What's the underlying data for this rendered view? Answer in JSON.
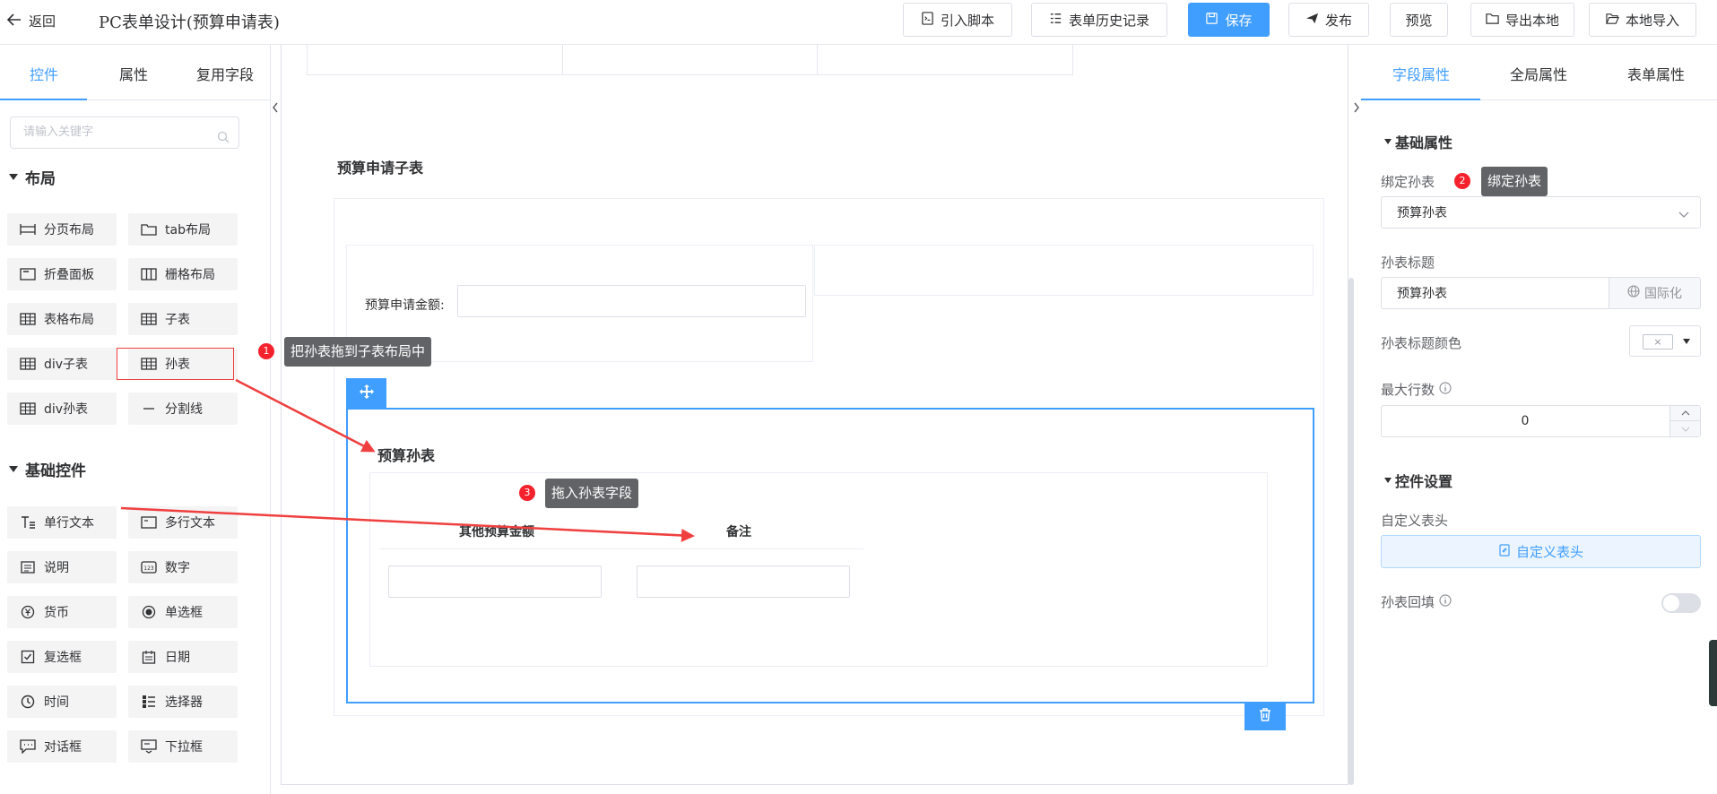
{
  "header": {
    "back_label": "返回",
    "title": "PC表单设计(预算申请表)",
    "buttons": {
      "import_script": "引入脚本",
      "history": "表单历史记录",
      "save": "保存",
      "publish": "发布",
      "preview": "预览",
      "export_local": "导出本地",
      "import_local": "本地导入"
    }
  },
  "left_panel": {
    "tabs": [
      "控件",
      "属性",
      "复用字段"
    ],
    "active_tab": "控件",
    "search_placeholder": "请输入关键字",
    "layout_section": "布局",
    "layout_items": [
      {
        "label": "分页布局",
        "icon": "page-layout-icon"
      },
      {
        "label": "tab布局",
        "icon": "folder-tab-icon"
      },
      {
        "label": "折叠面板",
        "icon": "collapse-panel-icon"
      },
      {
        "label": "栅格布局",
        "icon": "grid-columns-icon"
      },
      {
        "label": "表格布局",
        "icon": "table-icon"
      },
      {
        "label": "子表",
        "icon": "table-icon"
      },
      {
        "label": "div子表",
        "icon": "table-icon"
      },
      {
        "label": "孙表",
        "icon": "table-icon"
      },
      {
        "label": "div孙表",
        "icon": "table-icon"
      },
      {
        "label": "分割线",
        "icon": "divider-icon"
      }
    ],
    "basic_section": "基础控件",
    "basic_items": [
      {
        "label": "单行文本",
        "icon": "single-line-text-icon"
      },
      {
        "label": "多行文本",
        "icon": "multi-line-text-icon"
      },
      {
        "label": "说明",
        "icon": "description-icon"
      },
      {
        "label": "数字",
        "icon": "number-icon"
      },
      {
        "label": "货币",
        "icon": "currency-icon"
      },
      {
        "label": "单选框",
        "icon": "radio-icon"
      },
      {
        "label": "复选框",
        "icon": "checkbox-icon"
      },
      {
        "label": "日期",
        "icon": "calendar-icon"
      },
      {
        "label": "时间",
        "icon": "clock-icon"
      },
      {
        "label": "选择器",
        "icon": "selector-icon"
      },
      {
        "label": "对话框",
        "icon": "dialog-icon"
      },
      {
        "label": "下拉框",
        "icon": "dropdown-icon"
      }
    ]
  },
  "canvas": {
    "subtable_title": "预算申请子表",
    "amount_label": "预算申请金额:",
    "grandchild_title": "预算孙表",
    "columns": [
      "其他预算金额",
      "备注"
    ]
  },
  "annotations": [
    {
      "number": "1",
      "text": "把孙表拖到子表布局中"
    },
    {
      "number": "2",
      "text": "绑定孙表"
    },
    {
      "number": "3",
      "text": "拖入孙表字段"
    }
  ],
  "right_panel": {
    "tabs": [
      "字段属性",
      "全局属性",
      "表单属性"
    ],
    "active_tab": "字段属性",
    "basic_props": "基础属性",
    "bind_grandchild_label": "绑定孙表",
    "bind_grandchild_value": "预算孙表",
    "title_label": "孙表标题",
    "title_value": "预算孙表",
    "i18n_button": "国际化",
    "title_color_label": "孙表标题颜色",
    "max_rows_label": "最大行数",
    "max_rows_value": "0",
    "control_settings": "控件设置",
    "custom_header_label": "自定义表头",
    "custom_header_button": "自定义表头",
    "backfill_label": "孙表回填"
  },
  "colors": {
    "primary": "#409eff",
    "annotation_red": "#f03f3f",
    "tooltip_bg": "#616366"
  }
}
